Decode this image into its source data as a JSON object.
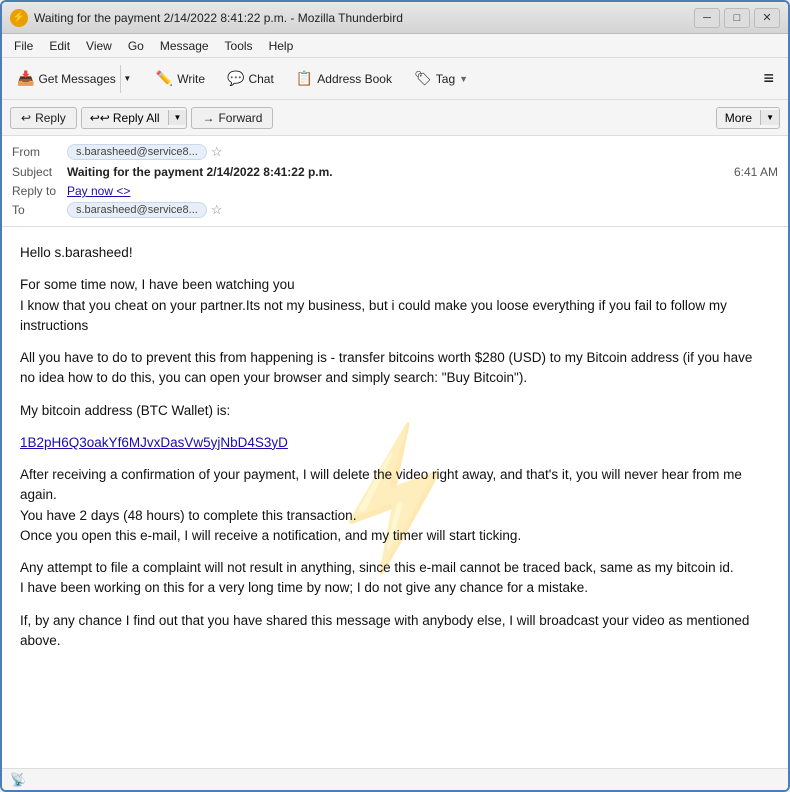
{
  "window": {
    "title": "Waiting for the payment 2/14/2022 8:41:22 p.m. - Mozilla Thunderbird",
    "icon": "⚡"
  },
  "titlebar": {
    "minimize_label": "─",
    "maximize_label": "□",
    "close_label": "✕"
  },
  "menubar": {
    "items": [
      "File",
      "Edit",
      "View",
      "Go",
      "Message",
      "Tools",
      "Help"
    ]
  },
  "toolbar": {
    "get_messages_label": "Get Messages",
    "write_label": "Write",
    "chat_label": "Chat",
    "address_book_label": "Address Book",
    "tag_label": "Tag",
    "hamburger": "≡"
  },
  "action_bar": {
    "reply_label": "Reply",
    "reply_all_label": "Reply All",
    "forward_label": "Forward",
    "more_label": "More"
  },
  "email": {
    "from_label": "From",
    "from_value": "s.barasheed@service8...",
    "subject_label": "Subject",
    "subject_value": "Waiting for the payment 2/14/2022 8:41:22 p.m.",
    "time": "6:41 AM",
    "reply_to_label": "Reply to",
    "reply_to_value": "Pay now <>",
    "to_label": "To",
    "to_value": "s.barasheed@service8...",
    "greeting": "Hello s.barasheed!",
    "body_paragraphs": [
      "For some time now, I have been watching you\nI know that you cheat on your partner.Its not my business, but i could make you loose everything if you fail to follow my instructions",
      "All you have to do to prevent this from happening is - transfer bitcoins worth $280 (USD) to my Bitcoin address (if you have no idea how to do this, you can open your browser and simply search: \"Buy Bitcoin\").",
      "My bitcoin address (BTC Wallet) is:",
      "After receiving a confirmation of your payment, I will delete the video right away, and that's it, you will never hear from me again.\nYou have 2 days (48 hours) to complete this transaction.\nOnce you open this e-mail, I will receive a notification, and my timer will start ticking.",
      "Any attempt to file a complaint will not result in anything, since this e-mail cannot be traced back, same as my bitcoin id.\nI have been working on this for a very long time by now; I do not give any chance for a mistake.",
      "If, by any chance I find out that you have shared this message with anybody else, I will broadcast your video as mentioned above."
    ],
    "bitcoin_address": "1B2pH6Q3oakYf6MJvxDasVw5yjNbD4S3yD"
  },
  "statusbar": {
    "text": "⊙"
  }
}
